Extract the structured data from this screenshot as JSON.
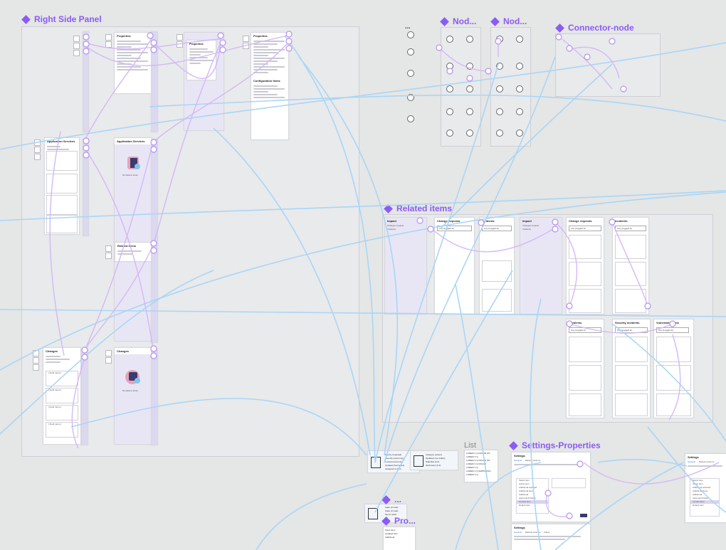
{
  "sections": {
    "right_side_panel": "Right Side Panel",
    "nodes_1": "Nod...",
    "nodes_2": "Nod...",
    "connector_node": "Connector-node",
    "related_items": "Related items",
    "settings_properties": "Settings-Properties",
    "dots": "...",
    "pro": "Pro..."
  },
  "right_panel": {
    "properties_1": "Properties",
    "properties_2": "Properties",
    "properties_3": "Properties",
    "application_services": "Application Services",
    "application_services_2": "Application Services",
    "related_items_short": "Related items",
    "changes": "Changes",
    "changes_2": "Changes",
    "configuration_items": "Configuration items",
    "no_data": "No data to show",
    "tag_items": "[ Field name ]"
  },
  "related": {
    "impact": "Impact",
    "change_requests": "Change requests",
    "incidents": "Incidents",
    "impact_2": "Impact",
    "change_requests_2": "Change requests",
    "incidents_2": "Incidents",
    "problems": "Problems",
    "security_incidents": "Security incidents",
    "vulnerable_items": "Vulnerable items",
    "filter_default": "Any (Logged in)",
    "impact_items": [
      "Changes impacts",
      "Incidents"
    ]
  },
  "list": {
    "title": "List",
    "lines": [
      "LOREM V Q DOLOR SIT",
      "LOREM V Q",
      "LOREM V Q DOLOR SIT",
      "LOREM V Q DOLOR",
      "LOREM V Q",
      "LOREM V Q ADIPISCING",
      "LOREM V Q"
    ]
  },
  "settings": {
    "title_1": "Settings",
    "title_2": "Settings",
    "title_3": "Settings",
    "tab_general": "General",
    "tab_defaults": "Default columns",
    "tab_filters": "Filters",
    "list_items": [
      "Select item",
      "Active item",
      "Additional selected",
      "Additional items",
      "Additional",
      "Approval Problem",
      "Current item",
      "Default item"
    ],
    "selected_item": "Current item"
  },
  "mini_cards": {
    "card_a": [
      "Priority (required)",
      "Security (read only)",
      "Locked (read only)",
      "Updated (formatted)",
      "Assigned to (0 2)",
      "Worknotes (0 2)"
    ],
    "card_b": [
      "Category (select)",
      "Updated (not visible)",
      "Watchlist (0 2)",
      "Worknotes (0 2)"
    ],
    "card_c": [
      "State (0 read)",
      "State (0 read)",
      "Set (0 read)"
    ],
    "card_d": [
      "Short desc",
      "Updated item",
      "Additional"
    ]
  },
  "colors": {
    "background": "#e5e6e6",
    "accent_purple": "#8a5cf5",
    "wire_blue": "#a9d6f5",
    "wire_purple": "#d4b8f5",
    "frame_lavender": "#dcd8ef"
  }
}
